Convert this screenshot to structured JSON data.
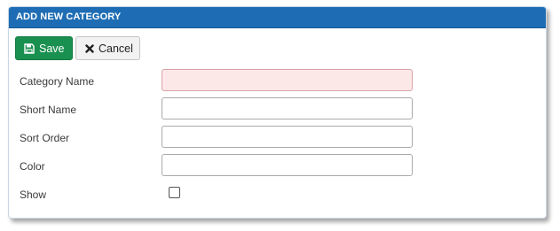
{
  "panel": {
    "title": "ADD NEW CATEGORY",
    "header_color": "#1e6db4"
  },
  "toolbar": {
    "save_label": "Save",
    "save_icon": "floppy-disk-icon",
    "save_color": "#1a9050",
    "cancel_label": "Cancel",
    "cancel_icon": "close-icon"
  },
  "form": {
    "category_name": {
      "label": "Category Name",
      "value": "",
      "invalid": true
    },
    "short_name": {
      "label": "Short Name",
      "value": ""
    },
    "sort_order": {
      "label": "Sort Order",
      "value": ""
    },
    "color": {
      "label": "Color",
      "value": ""
    },
    "show": {
      "label": "Show",
      "checked": false
    }
  }
}
